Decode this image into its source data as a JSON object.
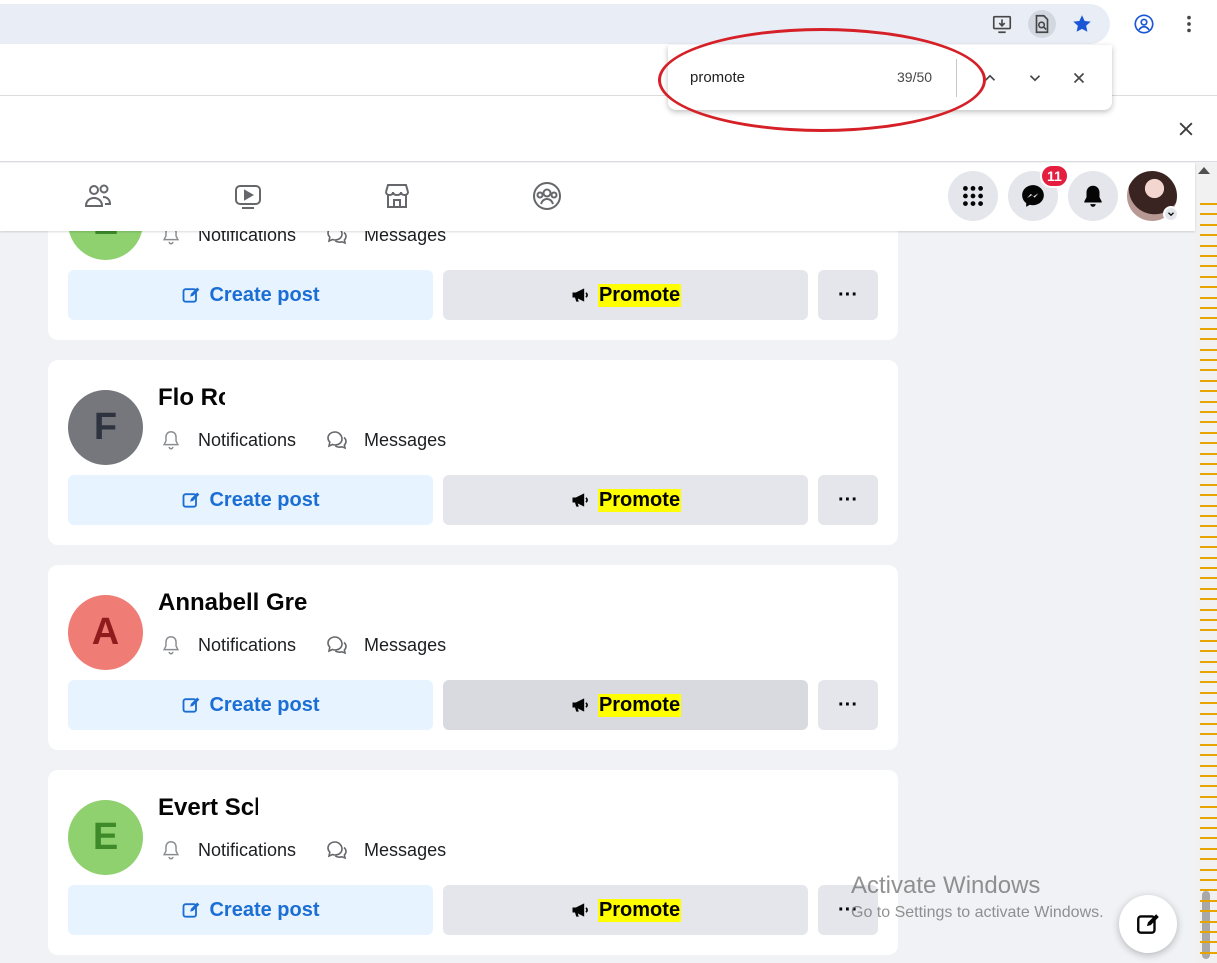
{
  "find_bar": {
    "query": "promote",
    "match_count": "39/50"
  },
  "messenger_badge": "11",
  "colors": {
    "accent": "#1b6ed3",
    "highlight": "#ffff00",
    "badge": "#e41e3f",
    "annotation": "#d62027"
  },
  "pages": [
    {
      "name": "",
      "initial": "E",
      "avatar_bg": "#8fd16f",
      "initial_color": "#3e8a2a"
    },
    {
      "name": "Flo Rc",
      "initial": "F",
      "avatar_bg": "#76777c",
      "initial_color": "#2e3340"
    },
    {
      "name": "Annabell Gre",
      "initial": "A",
      "avatar_bg": "#ef7d75",
      "initial_color": "#8e1c1c"
    },
    {
      "name": "Evert Scl",
      "initial": "E",
      "avatar_bg": "#8fd16f",
      "initial_color": "#3e8a2a"
    }
  ],
  "card_labels": {
    "notifications": "Notifications",
    "messages": "Messages",
    "create_post": "Create post",
    "promote": "Promote",
    "more": "···"
  },
  "watermark": {
    "title": "Activate Windows",
    "subtitle": "Go to Settings to activate Windows."
  }
}
